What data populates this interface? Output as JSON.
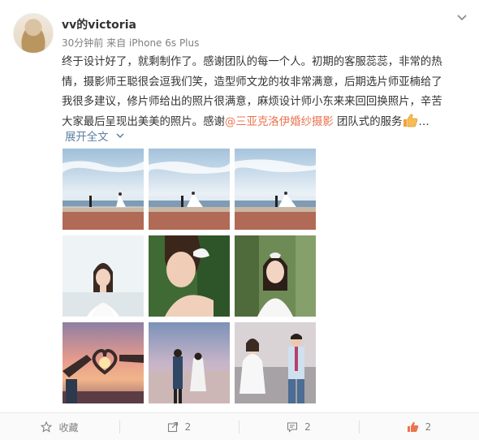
{
  "post": {
    "username": "vv的victoria",
    "time": "30分钟前",
    "source": "来自 iPhone 6s Plus",
    "text_lines": [
      "终于设计好了，就剩制作了。感谢团队的每一个人。初期的客服蕊蕊，非常的热",
      "情，摄影师王聪很会逗我们笑，造型师文龙的妆非常满意，后期选片师亚楠给了",
      "我很多建议，修片师给出的照片很满意，麻烦设计师小东来来回回换照片，辛苦",
      "大家最后呈现出美美的照片。感谢"
    ],
    "mention": "@三亚克洛伊婚纱摄影",
    "text_tail": " 团队式的服务",
    "ellipsis": "…",
    "expand_label": "展开全文"
  },
  "photos": [
    {
      "icon": "photo-seaside-wedding-1"
    },
    {
      "icon": "photo-seaside-wedding-2"
    },
    {
      "icon": "photo-seaside-wedding-3"
    },
    {
      "icon": "photo-bride-portrait"
    },
    {
      "icon": "photo-bride-closeup"
    },
    {
      "icon": "photo-bride-garden"
    },
    {
      "icon": "photo-heart-hands-sunset"
    },
    {
      "icon": "photo-couple-beach"
    },
    {
      "icon": "photo-couple-walkway"
    }
  ],
  "footer": {
    "favorite_label": "收藏",
    "repost_count": "2",
    "comment_count": "2",
    "like_count": "2"
  },
  "colors": {
    "mention": "#eb7350",
    "expand": "#5d7fa0",
    "like": "#eb7350",
    "meta": "#808080"
  }
}
